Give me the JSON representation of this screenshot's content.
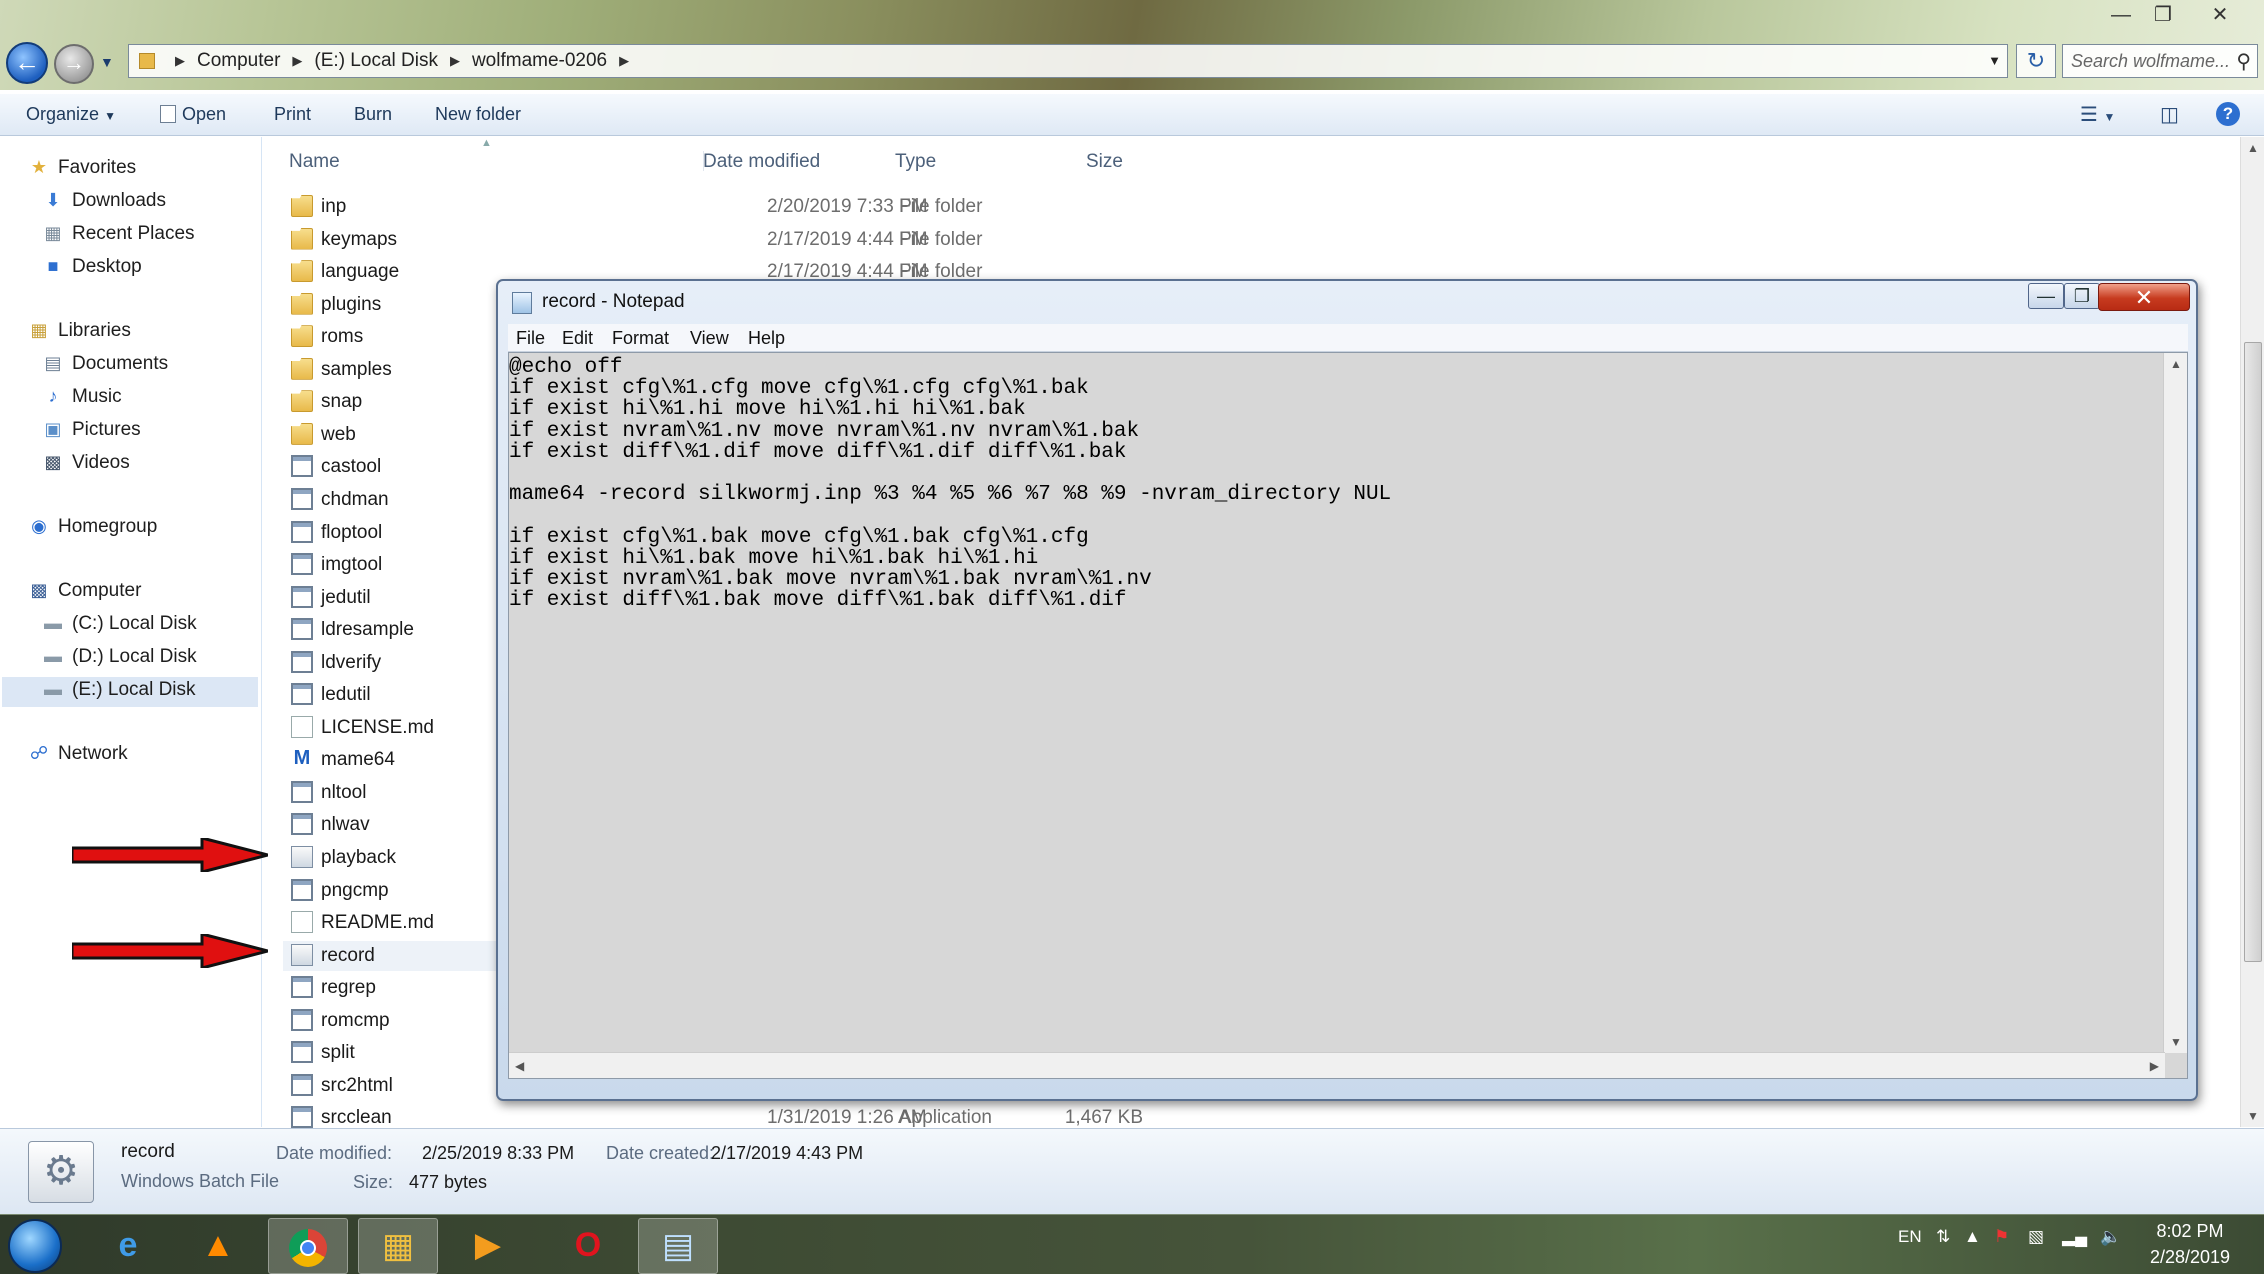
{
  "explorer": {
    "address": [
      "Computer",
      "(E:) Local Disk",
      "wolfmame-0206"
    ],
    "search_placeholder": "Search wolfmame...",
    "toolbar": {
      "organize": "Organize",
      "open": "Open",
      "print": "Print",
      "burn": "Burn",
      "new_folder": "New folder"
    },
    "nav": {
      "favorites": "Favorites",
      "downloads": "Downloads",
      "recent_places": "Recent Places",
      "desktop": "Desktop",
      "libraries": "Libraries",
      "documents": "Documents",
      "music": "Music",
      "pictures": "Pictures",
      "videos": "Videos",
      "homegroup": "Homegroup",
      "computer": "Computer",
      "c_disk": "(C:) Local Disk",
      "d_disk": "(D:) Local Disk",
      "e_disk": "(E:) Local Disk",
      "network": "Network"
    },
    "columns": {
      "name": "Name",
      "date": "Date modified",
      "type": "Type",
      "size": "Size"
    },
    "files": [
      {
        "name": "inp",
        "date": "2/20/2019 7:33 PM",
        "type": "File folder",
        "size": "",
        "icon": "folder-icon"
      },
      {
        "name": "keymaps",
        "date": "2/17/2019 4:44 PM",
        "type": "File folder",
        "size": "",
        "icon": "folder-icon"
      },
      {
        "name": "language",
        "date": "2/17/2019 4:44 PM",
        "type": "File folder",
        "size": "",
        "icon": "folder-icon"
      },
      {
        "name": "plugins",
        "date": "",
        "type": "",
        "size": "",
        "icon": "folder-icon"
      },
      {
        "name": "roms",
        "date": "",
        "type": "",
        "size": "",
        "icon": "folder-icon"
      },
      {
        "name": "samples",
        "date": "",
        "type": "",
        "size": "",
        "icon": "folder-icon"
      },
      {
        "name": "snap",
        "date": "",
        "type": "",
        "size": "",
        "icon": "folder-icon"
      },
      {
        "name": "web",
        "date": "",
        "type": "",
        "size": "",
        "icon": "folder-icon"
      },
      {
        "name": "castool",
        "date": "",
        "type": "",
        "size": "",
        "icon": "app-icon"
      },
      {
        "name": "chdman",
        "date": "",
        "type": "",
        "size": "",
        "icon": "app-icon"
      },
      {
        "name": "floptool",
        "date": "",
        "type": "",
        "size": "",
        "icon": "app-icon"
      },
      {
        "name": "imgtool",
        "date": "",
        "type": "",
        "size": "",
        "icon": "app-icon"
      },
      {
        "name": "jedutil",
        "date": "",
        "type": "",
        "size": "",
        "icon": "app-icon"
      },
      {
        "name": "ldresample",
        "date": "",
        "type": "",
        "size": "",
        "icon": "app-icon"
      },
      {
        "name": "ldverify",
        "date": "",
        "type": "",
        "size": "",
        "icon": "app-icon"
      },
      {
        "name": "ledutil",
        "date": "",
        "type": "",
        "size": "",
        "icon": "app-icon"
      },
      {
        "name": "LICENSE.md",
        "date": "",
        "type": "",
        "size": "",
        "icon": "document-icon"
      },
      {
        "name": "mame64",
        "date": "",
        "type": "",
        "size": "",
        "icon": "mame-icon"
      },
      {
        "name": "nltool",
        "date": "",
        "type": "",
        "size": "",
        "icon": "app-icon"
      },
      {
        "name": "nlwav",
        "date": "",
        "type": "",
        "size": "",
        "icon": "app-icon"
      },
      {
        "name": "playback",
        "date": "",
        "type": "",
        "size": "",
        "icon": "batch-file-icon"
      },
      {
        "name": "pngcmp",
        "date": "",
        "type": "",
        "size": "",
        "icon": "app-icon"
      },
      {
        "name": "README.md",
        "date": "",
        "type": "",
        "size": "",
        "icon": "document-icon"
      },
      {
        "name": "record",
        "date": "",
        "type": "",
        "size": "",
        "icon": "batch-file-icon",
        "selected": true
      },
      {
        "name": "regrep",
        "date": "",
        "type": "",
        "size": "",
        "icon": "app-icon"
      },
      {
        "name": "romcmp",
        "date": "",
        "type": "",
        "size": "",
        "icon": "app-icon"
      },
      {
        "name": "split",
        "date": "",
        "type": "",
        "size": "",
        "icon": "app-icon"
      },
      {
        "name": "src2html",
        "date": "",
        "type": "",
        "size": "",
        "icon": "app-icon"
      },
      {
        "name": "srcclean",
        "date": "1/31/2019 1:26 AM",
        "type": "Application",
        "size": "1,467 KB",
        "icon": "app-icon"
      }
    ],
    "details": {
      "name": "record",
      "kind": "Windows Batch File",
      "date_modified_label": "Date modified:",
      "date_modified": "2/25/2019 8:33 PM",
      "date_created_label": "Date created:",
      "date_created": "2/17/2019 4:43 PM",
      "size_label": "Size:",
      "size": "477 bytes"
    }
  },
  "notepad": {
    "title": "record - Notepad",
    "menu": [
      "File",
      "Edit",
      "Format",
      "View",
      "Help"
    ],
    "content": "@echo off\nif exist cfg\\%1.cfg move cfg\\%1.cfg cfg\\%1.bak\nif exist hi\\%1.hi move hi\\%1.hi hi\\%1.bak\nif exist nvram\\%1.nv move nvram\\%1.nv nvram\\%1.bak\nif exist diff\\%1.dif move diff\\%1.dif diff\\%1.bak\n\nmame64 -record silkwormj.inp %3 %4 %5 %6 %7 %8 %9 -nvram_directory NUL\n\nif exist cfg\\%1.bak move cfg\\%1.bak cfg\\%1.cfg\nif exist hi\\%1.bak move hi\\%1.bak hi\\%1.hi\nif exist nvram\\%1.bak move nvram\\%1.bak nvram\\%1.nv\nif exist diff\\%1.bak move diff\\%1.bak diff\\%1.dif"
  },
  "taskbar": {
    "apps": [
      "internet-explorer-icon",
      "vlc-icon",
      "chrome-icon",
      "file-explorer-icon",
      "media-player-icon",
      "opera-icon",
      "notepad-icon"
    ],
    "language": "EN",
    "time": "8:02 PM",
    "date": "2/28/2019"
  },
  "colors": {
    "arrow": "#e01010",
    "accent": "#1e5fbf",
    "selection": "#dce7f5"
  }
}
